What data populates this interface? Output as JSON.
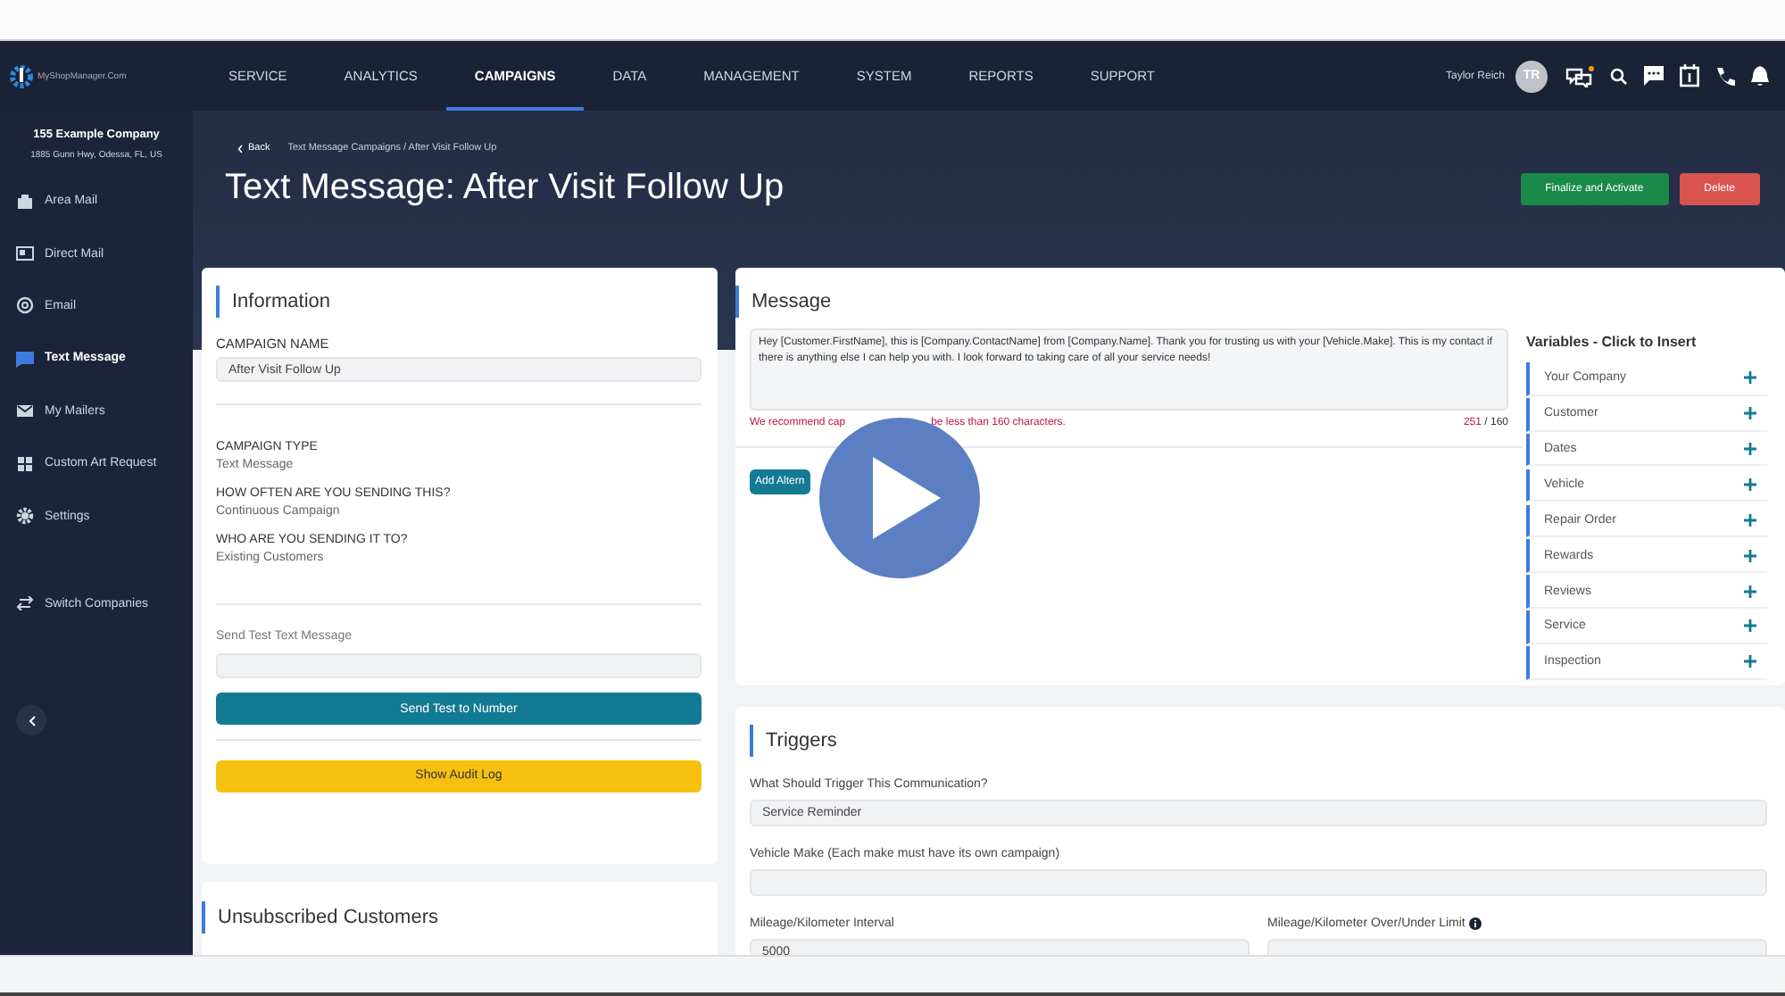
{
  "nav": {
    "logo_text": "MyShopManager.Com",
    "items": [
      {
        "label": "SERVICE",
        "selected": false
      },
      {
        "label": "ANALYTICS",
        "selected": false
      },
      {
        "label": "CAMPAIGNS",
        "selected": true
      },
      {
        "label": "DATA",
        "selected": false
      },
      {
        "label": "MANAGEMENT",
        "selected": false
      },
      {
        "label": "SYSTEM",
        "selected": false
      },
      {
        "label": "REPORTS",
        "selected": false
      },
      {
        "label": "SUPPORT",
        "selected": false
      }
    ],
    "user_name": "Taylor Reich",
    "avatar_initials": "TR"
  },
  "sidebar": {
    "company": "155 Example Company",
    "address": "1885 Gunn Hwy, Odessa, FL, US",
    "items": [
      {
        "label": "Area Mail",
        "selected": false
      },
      {
        "label": "Direct Mail",
        "selected": false
      },
      {
        "label": "Email",
        "selected": false
      },
      {
        "label": "Text Message",
        "selected": true
      },
      {
        "label": "My Mailers",
        "selected": false
      },
      {
        "label": "Custom Art Request",
        "selected": false
      },
      {
        "label": "Settings",
        "selected": false
      }
    ],
    "switch_label": "Switch Companies"
  },
  "header": {
    "back": "Back",
    "breadcrumb": "Text Message Campaigns / After Visit Follow Up",
    "title": "Text Message: After Visit Follow Up",
    "buttons": [
      {
        "label": "Finalize and Activate",
        "kind": "primary"
      },
      {
        "label": "Delete",
        "kind": "danger"
      }
    ]
  },
  "information": {
    "title": "Information",
    "name_label": "CAMPAIGN NAME",
    "name_value": "After Visit Follow Up",
    "details": [
      {
        "label": "CAMPAIGN TYPE",
        "value": "Text Message"
      },
      {
        "label": "HOW OFTEN ARE YOU SENDING THIS?",
        "value": "Continuous Campaign"
      },
      {
        "label": "WHO ARE YOU SENDING IT TO?",
        "value": "Existing Customers"
      }
    ],
    "test_label": "Send Test Text Message",
    "send_button": "Send Test to Number",
    "audit_button": "Show Audit Log"
  },
  "message": {
    "title": "Message",
    "text": "Hey [Customer.FirstName], this is [Company.ContactName] from [Company.Name]. Thank you for trusting us with your [Vehicle.Make]. This is my contact if there is anything else I can help you with. I look forward to taking care of all your service needs!",
    "warning_start": "We recommend cap",
    "warning_end": "be less than 160 characters.",
    "count": "251",
    "limit": "/ 160",
    "add_button": "Add Altern",
    "variables_title": "Variables - Click to Insert",
    "variables": [
      "Your Company",
      "Customer",
      "Dates",
      "Vehicle",
      "Repair Order",
      "Rewards",
      "Reviews",
      "Service",
      "Inspection"
    ]
  },
  "triggers": {
    "title": "Triggers",
    "trigger_label": "What Should Trigger This Communication?",
    "trigger_value": "Service Reminder",
    "make_label": "Vehicle Make (Each make must have its own campaign)",
    "interval_label": "Mileage/Kilometer Interval",
    "interval_value": "5000",
    "limit_label": "Mileage/Kilometer Over/Under Limit"
  },
  "unsubscribed": {
    "title": "Unsubscribed Customers"
  }
}
